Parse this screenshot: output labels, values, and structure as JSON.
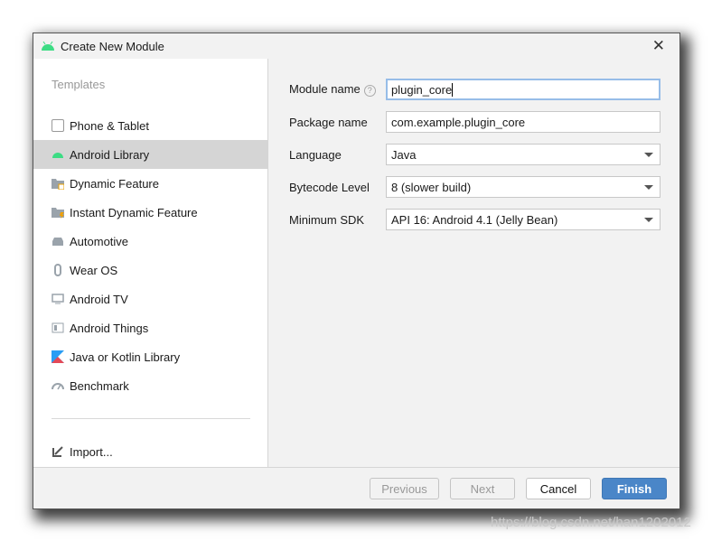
{
  "window": {
    "title": "Create New Module",
    "close": "✕"
  },
  "sidebar": {
    "heading": "Templates",
    "items": [
      {
        "label": "Phone & Tablet",
        "icon": "phone-tablet-icon"
      },
      {
        "label": "Android Library",
        "icon": "android-icon",
        "selected": true
      },
      {
        "label": "Dynamic Feature",
        "icon": "folder-feature-icon"
      },
      {
        "label": "Instant Dynamic Feature",
        "icon": "folder-instant-icon"
      },
      {
        "label": "Automotive",
        "icon": "car-icon"
      },
      {
        "label": "Wear OS",
        "icon": "watch-icon"
      },
      {
        "label": "Android TV",
        "icon": "tv-icon"
      },
      {
        "label": "Android Things",
        "icon": "things-icon"
      },
      {
        "label": "Java or Kotlin Library",
        "icon": "kotlin-icon"
      },
      {
        "label": "Benchmark",
        "icon": "gauge-icon"
      }
    ],
    "import": "Import..."
  },
  "form": {
    "module_name": {
      "label": "Module name",
      "help": "?",
      "value": "plugin_core"
    },
    "package_name": {
      "label": "Package name",
      "value": "com.example.plugin_core"
    },
    "language": {
      "label": "Language",
      "value": "Java"
    },
    "bytecode": {
      "label": "Bytecode Level",
      "value": "8 (slower build)"
    },
    "min_sdk": {
      "label": "Minimum SDK",
      "value": "API 16: Android 4.1 (Jelly Bean)"
    }
  },
  "footer": {
    "previous": "Previous",
    "next": "Next",
    "cancel": "Cancel",
    "finish": "Finish"
  },
  "watermark": "https://blog.csdn.net/han1202012",
  "colors": {
    "accent": "#4a86c8",
    "android": "#3ddc84",
    "selection": "#d5d5d5"
  }
}
